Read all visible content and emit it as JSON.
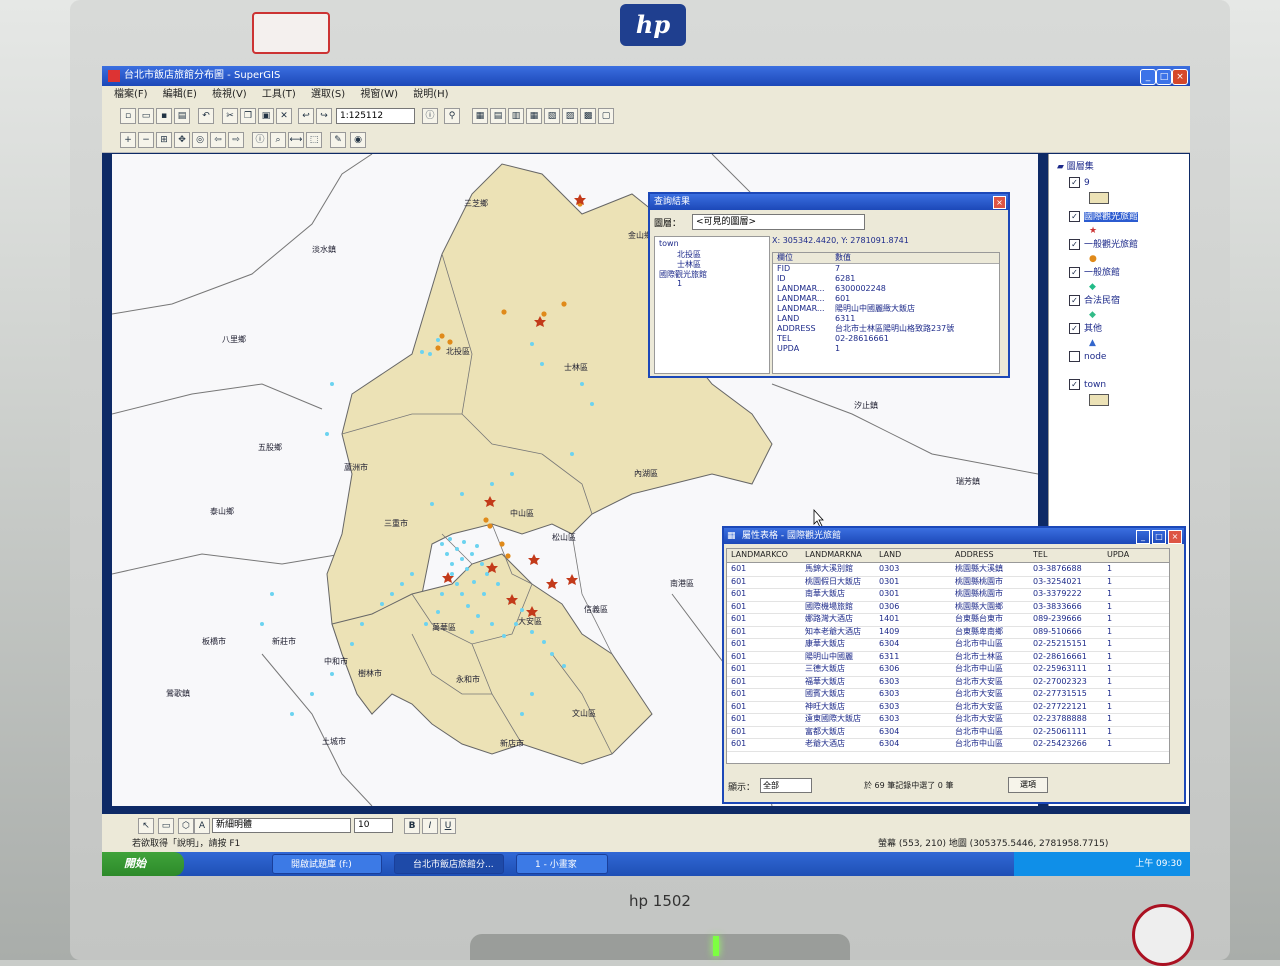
{
  "window": {
    "title": "台北市飯店旅館分布圖 - SuperGIS"
  },
  "menu": [
    "檔案(F)",
    "編輯(E)",
    "檢視(V)",
    "工具(T)",
    "選取(S)",
    "視窗(W)",
    "說明(H)"
  ],
  "toolbar": {
    "scale": "1:125112"
  },
  "map_labels": [
    {
      "text": "三芝鄉"
    },
    {
      "text": "淡水鎮"
    },
    {
      "text": "八里鄉"
    },
    {
      "text": "北投區"
    },
    {
      "text": "士林區"
    },
    {
      "text": "五股鄉"
    },
    {
      "text": "泰山鄉"
    },
    {
      "text": "蘆洲市"
    },
    {
      "text": "三重市"
    },
    {
      "text": "新莊市"
    },
    {
      "text": "樹林市"
    },
    {
      "text": "中山區"
    },
    {
      "text": "松山區"
    },
    {
      "text": "內湖區"
    },
    {
      "text": "南港區"
    },
    {
      "text": "大安區"
    },
    {
      "text": "信義區"
    },
    {
      "text": "萬華區"
    },
    {
      "text": "永和市"
    },
    {
      "text": "中和市"
    },
    {
      "text": "新店市"
    },
    {
      "text": "文山區"
    },
    {
      "text": "汐止鎮"
    },
    {
      "text": "瑞芳鎮"
    },
    {
      "text": "土城市"
    },
    {
      "text": "板橋市"
    },
    {
      "text": "鶯歌鎮"
    },
    {
      "text": "金山鄉"
    }
  ],
  "toc": {
    "title": "圖層集",
    "layers": [
      {
        "name": "9",
        "checked": true
      },
      {
        "name": "國際觀光旅館",
        "checked": true,
        "selected": true
      },
      {
        "name": "一般觀光旅館",
        "checked": true
      },
      {
        "name": "一般旅館",
        "checked": true
      },
      {
        "name": "合法民宿",
        "checked": true
      },
      {
        "name": "其他",
        "checked": true
      },
      {
        "name": "node",
        "checked": false
      },
      {
        "name": "town",
        "checked": true
      }
    ]
  },
  "identify": {
    "title": "查詢結果",
    "layer_label": "圖層：",
    "layer_value": "<可見的圖層>",
    "tree": [
      "town",
      "北投區",
      "士林區",
      "國際觀光旅館",
      "1"
    ],
    "xy": "X: 305342.4420, Y: 2781091.8741",
    "header": {
      "field": "欄位",
      "value": "數值"
    },
    "fields": [
      {
        "f": "FID",
        "v": "7"
      },
      {
        "f": "ID",
        "v": "6281"
      },
      {
        "f": "LANDMAR...",
        "v": "6300002248"
      },
      {
        "f": "LANDMAR...",
        "v": "601"
      },
      {
        "f": "LANDMAR...",
        "v": "陽明山中國麗緻大飯店"
      },
      {
        "f": "LAND",
        "v": "6311"
      },
      {
        "f": "ADDRESS",
        "v": "台北市士林區陽明山格致路237號"
      },
      {
        "f": "TEL",
        "v": "02-28616661"
      },
      {
        "f": "UPDA",
        "v": "1"
      }
    ]
  },
  "attr_table": {
    "title": "屬性表格 - 國際觀光旅館",
    "columns": [
      "LANDMARKCO",
      "LANDMARKNA",
      "LAND",
      "ADDRESS",
      "TEL",
      "UPDA"
    ],
    "rows": [
      [
        "601",
        "馬錦大溪別館",
        "0303",
        "桃園縣大溪鎮",
        "03-3876688",
        "1"
      ],
      [
        "601",
        "桃園假日大飯店",
        "0301",
        "桃園縣桃園市",
        "03-3254021",
        "1"
      ],
      [
        "601",
        "南華大飯店",
        "0301",
        "桃園縣桃園市",
        "03-3379222",
        "1"
      ],
      [
        "601",
        "國際機場旅館",
        "0306",
        "桃園縣大園鄉",
        "03-3833666",
        "1"
      ],
      [
        "601",
        "娜路灣大酒店",
        "1401",
        "台東縣台東市",
        "089-239666",
        "1"
      ],
      [
        "601",
        "知本老爺大酒店",
        "1409",
        "台東縣卑南鄉",
        "089-510666",
        "1"
      ],
      [
        "601",
        "康華大飯店",
        "6304",
        "台北市中山區",
        "02-25215151",
        "1"
      ],
      [
        "601",
        "陽明山中國麗",
        "6311",
        "台北市士林區",
        "02-28616661",
        "1"
      ],
      [
        "601",
        "三德大飯店",
        "6306",
        "台北市中山區",
        "02-25963111",
        "1"
      ],
      [
        "601",
        "福華大飯店",
        "6303",
        "台北市大安區",
        "02-27002323",
        "1"
      ],
      [
        "601",
        "國賓大飯店",
        "6303",
        "台北市大安區",
        "02-27731515",
        "1"
      ],
      [
        "601",
        "神旺大飯店",
        "6303",
        "台北市大安區",
        "02-27722121",
        "1"
      ],
      [
        "601",
        "遠東國際大飯店",
        "6303",
        "台北市大安區",
        "02-23788888",
        "1"
      ],
      [
        "601",
        "富都大飯店",
        "6304",
        "台北市中山區",
        "02-25061111",
        "1"
      ],
      [
        "601",
        "老爺大酒店",
        "6304",
        "台北市中山區",
        "02-25423266",
        "1"
      ]
    ],
    "show_label": "顯示：",
    "show_value": "全部",
    "status_msg": "於 69 筆記錄中選了 0 筆",
    "options_button": "選項"
  },
  "drawing": {
    "font": "新細明體",
    "size": "10"
  },
  "status": {
    "left": "若欲取得「說明」，請按 F1",
    "coords": "螢幕 (553, 210) 地圖 (305375.5446, 2781958.7715)"
  },
  "taskbar": {
    "start": "開始",
    "tasks": [
      "開啟試題庫 (f:)",
      "台北市飯店旅館分...",
      "1 - 小畫家"
    ],
    "clock": "上午 09:30"
  },
  "monitor": {
    "model": "hp 1502",
    "logo": "hp"
  }
}
